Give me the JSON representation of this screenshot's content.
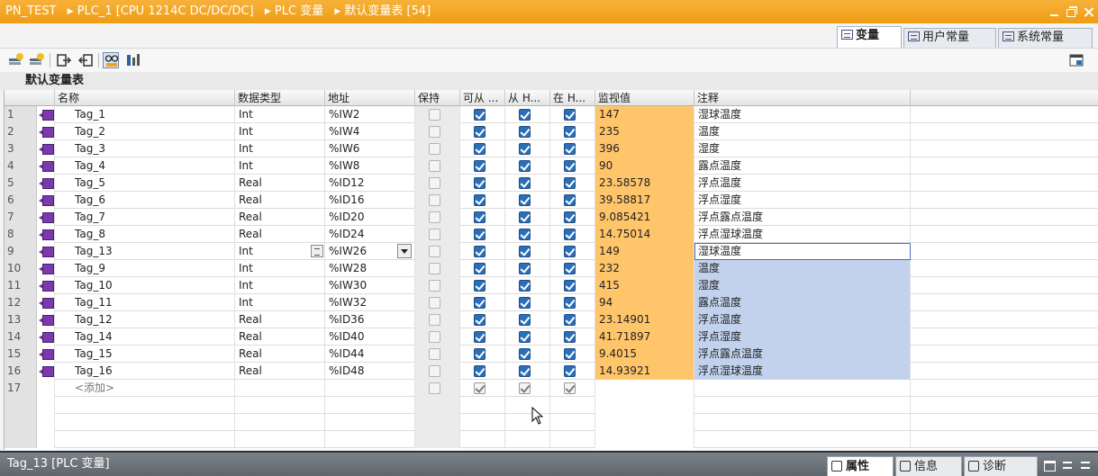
{
  "breadcrumb": [
    "PN_TEST",
    "PLC_1 [CPU 1214C DC/DC/DC]",
    "PLC 变量",
    "默认变量表 [54]"
  ],
  "tabs": [
    {
      "label": "变量",
      "active": true
    },
    {
      "label": "用户常量",
      "active": false
    },
    {
      "label": "系统常量",
      "active": false
    }
  ],
  "table_title": "默认变量表",
  "columns": {
    "name": "名称",
    "datatype": "数据类型",
    "address": "地址",
    "retain": "保持",
    "accessible": "可从 ...",
    "writable": "从 H...",
    "visible": "在 H...",
    "monitor": "监视值",
    "comment": "注释"
  },
  "rows": [
    {
      "num": "1",
      "name": "Tag_1",
      "type": "Int",
      "address": "%IW2",
      "value": "147",
      "comment": "湿球温度"
    },
    {
      "num": "2",
      "name": "Tag_2",
      "type": "Int",
      "address": "%IW4",
      "value": "235",
      "comment": "温度"
    },
    {
      "num": "3",
      "name": "Tag_3",
      "type": "Int",
      "address": "%IW6",
      "value": "396",
      "comment": "湿度"
    },
    {
      "num": "4",
      "name": "Tag_4",
      "type": "Int",
      "address": "%IW8",
      "value": "90",
      "comment": "露点温度"
    },
    {
      "num": "5",
      "name": "Tag_5",
      "type": "Real",
      "address": "%ID12",
      "value": "23.58578",
      "comment": "浮点温度"
    },
    {
      "num": "6",
      "name": "Tag_6",
      "type": "Real",
      "address": "%ID16",
      "value": "39.58817",
      "comment": "浮点湿度"
    },
    {
      "num": "7",
      "name": "Tag_7",
      "type": "Real",
      "address": "%ID20",
      "value": "9.085421",
      "comment": "浮点露点温度"
    },
    {
      "num": "8",
      "name": "Tag_8",
      "type": "Real",
      "address": "%ID24",
      "value": "14.75014",
      "comment": "浮点湿球温度"
    },
    {
      "num": "9",
      "name": "Tag_13",
      "type": "Int",
      "address": "%IW26",
      "value": "149",
      "comment": "湿球温度"
    },
    {
      "num": "10",
      "name": "Tag_9",
      "type": "Int",
      "address": "%IW28",
      "value": "232",
      "comment": "温度"
    },
    {
      "num": "11",
      "name": "Tag_10",
      "type": "Int",
      "address": "%IW30",
      "value": "415",
      "comment": "湿度"
    },
    {
      "num": "12",
      "name": "Tag_11",
      "type": "Int",
      "address": "%IW32",
      "value": "94",
      "comment": "露点温度"
    },
    {
      "num": "13",
      "name": "Tag_12",
      "type": "Real",
      "address": "%ID36",
      "value": "23.14901",
      "comment": "浮点温度"
    },
    {
      "num": "14",
      "name": "Tag_14",
      "type": "Real",
      "address": "%ID40",
      "value": "41.71897",
      "comment": "浮点湿度"
    },
    {
      "num": "15",
      "name": "Tag_15",
      "type": "Real",
      "address": "%ID44",
      "value": "9.4015",
      "comment": "浮点露点温度"
    },
    {
      "num": "16",
      "name": "Tag_16",
      "type": "Real",
      "address": "%ID48",
      "value": "14.93921",
      "comment": "浮点湿球温度"
    }
  ],
  "add_row": {
    "num": "17",
    "label": "<添加>"
  },
  "status": {
    "title": "Tag_13 [PLC 变量]",
    "tabs": [
      "属性",
      "信息",
      "诊断"
    ]
  },
  "colors": {
    "title_bar": "#f5a623",
    "monitor_cell": "#ffc56b",
    "checkbox": "#2b6fb8",
    "selection": "#c2d2ec"
  }
}
